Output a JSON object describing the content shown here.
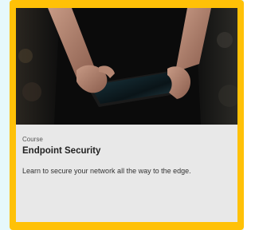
{
  "card": {
    "image_alt": "Person holding a tablet",
    "eyebrow": "Course",
    "title": "Endpoint Security",
    "description": "Learn to secure your network all the way to the edge."
  },
  "colors": {
    "card_border": "#ffc107",
    "card_bg": "#e8e8e8",
    "backdrop": "#e6f8fb"
  }
}
